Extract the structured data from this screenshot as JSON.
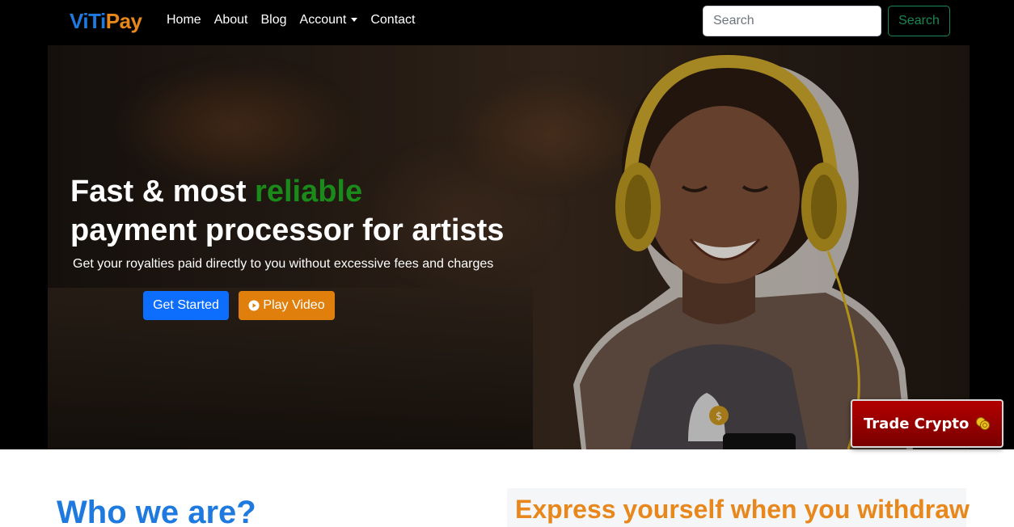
{
  "brand": {
    "part1": "ViTi",
    "part2": "Pay"
  },
  "nav": {
    "items": [
      {
        "label": "Home"
      },
      {
        "label": "About"
      },
      {
        "label": "Blog"
      },
      {
        "label": "Account"
      },
      {
        "label": "Contact"
      }
    ],
    "search_placeholder": "Search",
    "search_button": "Search"
  },
  "hero": {
    "title_part1": "Fast & most ",
    "title_accent": "reliable",
    "title_line2": "payment processor for artists",
    "subtitle": "Get your royalties paid directly to you without excessive fees and charges",
    "get_started": "Get Started",
    "play_video": "Play Video"
  },
  "trade_button": {
    "label": "Trade Crypto",
    "icon": "coins-icon"
  },
  "sections": {
    "who_heading": "Who we are?",
    "express_heading": "Express yourself when you withdraw"
  },
  "colors": {
    "brand_blue": "#1f7ae0",
    "brand_orange": "#e8871b",
    "accent_green": "#1a8a1a",
    "primary": "#0d6efd",
    "warning": "#e07f0c",
    "trade_red": "#a30000",
    "search_green": "#198754"
  }
}
